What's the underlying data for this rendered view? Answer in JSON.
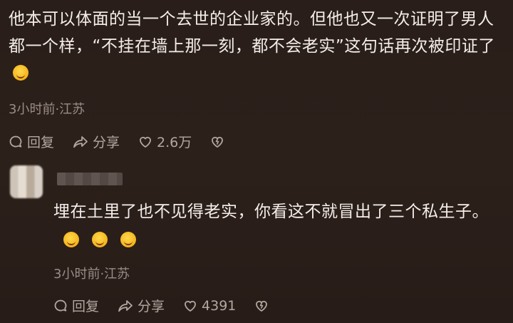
{
  "main_comment": {
    "text": "他本可以体面的当一个去世的企业家的。但他也又一次证明了男人都一个样，“不挂在墙上那一刻，都不会老实”这句话再次被印证了",
    "emoji": "rofl-emoji",
    "time_location": "3小时前·江苏",
    "actions": {
      "reply_label": "回复",
      "share_label": "分享",
      "like_count": "2.6万"
    }
  },
  "reply_comment": {
    "username": "",
    "text": "埋在土里了也不见得老实，你看这不就冒出了三个私生子。",
    "emojis": [
      "laughing-emoji",
      "laughing-emoji",
      "laughing-emoji"
    ],
    "time_location": "3小时前·江苏",
    "actions": {
      "reply_label": "回复",
      "share_label": "分享",
      "like_count": "4391"
    }
  },
  "colors": {
    "background": "#2a1e1a",
    "text": "#f4eeea",
    "meta": "#9a8d86",
    "action": "#b3a7a0"
  }
}
